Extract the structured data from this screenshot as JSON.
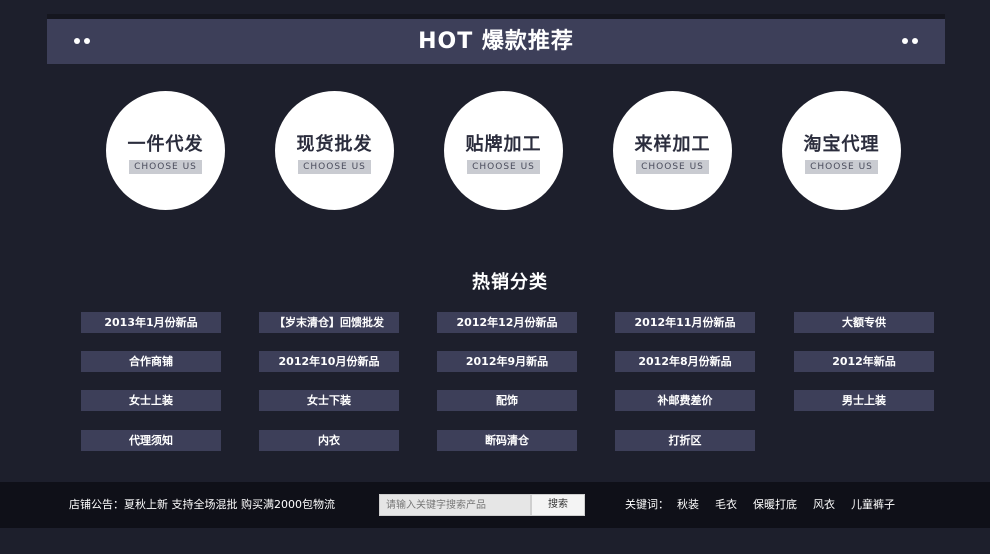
{
  "banner": {
    "title": "HOT 爆款推荐"
  },
  "services": [
    {
      "title": "一件代发",
      "subtitle": "CHOOSE US"
    },
    {
      "title": "现货批发",
      "subtitle": "CHOOSE US"
    },
    {
      "title": "贴牌加工",
      "subtitle": "CHOOSE US"
    },
    {
      "title": "来样加工",
      "subtitle": "CHOOSE US"
    },
    {
      "title": "淘宝代理",
      "subtitle": "CHOOSE US"
    }
  ],
  "hot_categories": {
    "title": "热销分类",
    "items": [
      "2013年1月份新品",
      "【岁末清仓】回馈批发",
      "2012年12月份新品",
      "2012年11月份新品",
      "大额专供",
      "合作商铺",
      "2012年10月份新品",
      "2012年9月新品",
      "2012年8月份新品",
      "2012年新品",
      "女士上装",
      "女士下装",
      "配饰",
      "补邮费差价",
      "男士上装",
      "代理须知",
      "内衣",
      "断码清仓",
      "打折区"
    ]
  },
  "footer": {
    "notice": "店铺公告：夏秋上新 支持全场混批 购买满2000包物流",
    "search_placeholder": "请输入关键字搜索产品",
    "search_button": "搜索",
    "keywords_label": "关键词：",
    "keywords": [
      "秋装",
      "毛衣",
      "保暖打底",
      "风衣",
      "儿童裤子"
    ]
  }
}
